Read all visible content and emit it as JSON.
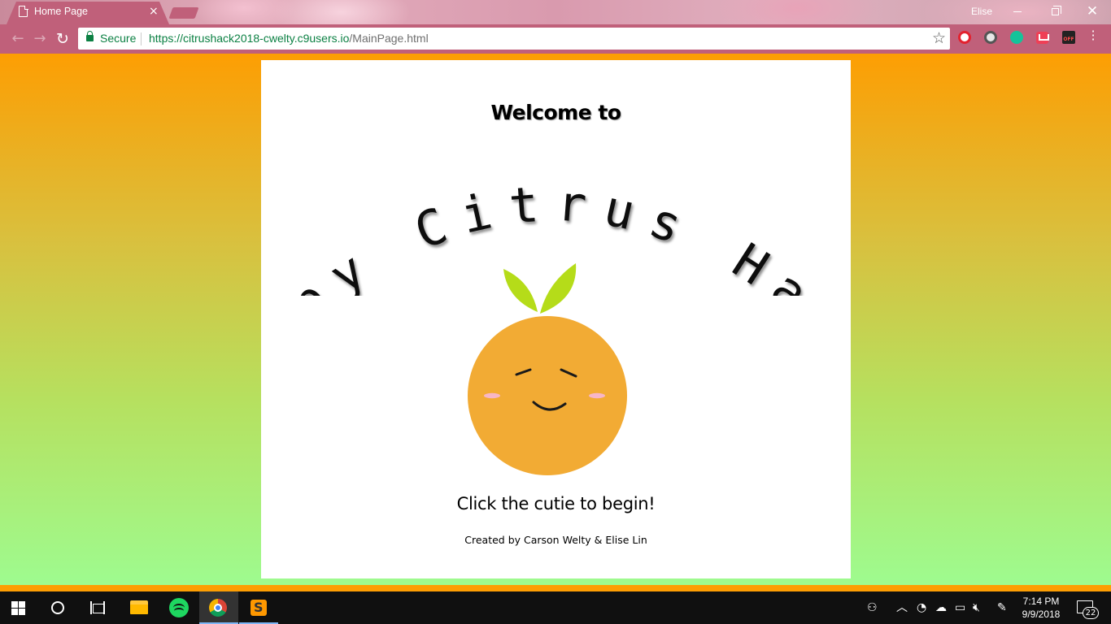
{
  "browser": {
    "tab_title": "Home Page",
    "tab_close": "×",
    "profile_name": "Elise",
    "secure_label": "Secure",
    "url_host": "https://citrushack2018-cwelty.c9users.io",
    "url_path": "/MainPage.html",
    "bookmark_icon": "star-icon",
    "extensions": [
      "opera-icon",
      "sync-icon",
      "grammarly-icon",
      "pocket-icon",
      "off-icon"
    ],
    "nav": {
      "back": "←",
      "forward": "→",
      "reload": "↻"
    },
    "window_controls": {
      "close": "✕"
    }
  },
  "page": {
    "welcome": "Welcome to",
    "title": "iSpy Citrus Hack",
    "instructions": "Click the cutie to begin!",
    "credits": "Created by Carson Welty & Elise Lin",
    "colors": {
      "gradient_top": "#fd9e03",
      "gradient_bottom": "#9efb8f",
      "orange": "#f2ab34",
      "leaf": "#b5dc19",
      "blush": "#f7b6c7"
    }
  },
  "taskbar": {
    "pinned": [
      "start-icon",
      "cortana-icon",
      "task-view-icon",
      "file-explorer-icon",
      "spotify-icon",
      "chrome-icon",
      "sublime-text-icon"
    ],
    "clock_time": "7:14 PM",
    "clock_date": "9/9/2018",
    "notification_count": "22",
    "tray": [
      "people-icon",
      "chevron-up-icon",
      "wifi-icon",
      "onedrive-icon",
      "battery-icon",
      "mute-icon",
      "pen-icon"
    ]
  }
}
